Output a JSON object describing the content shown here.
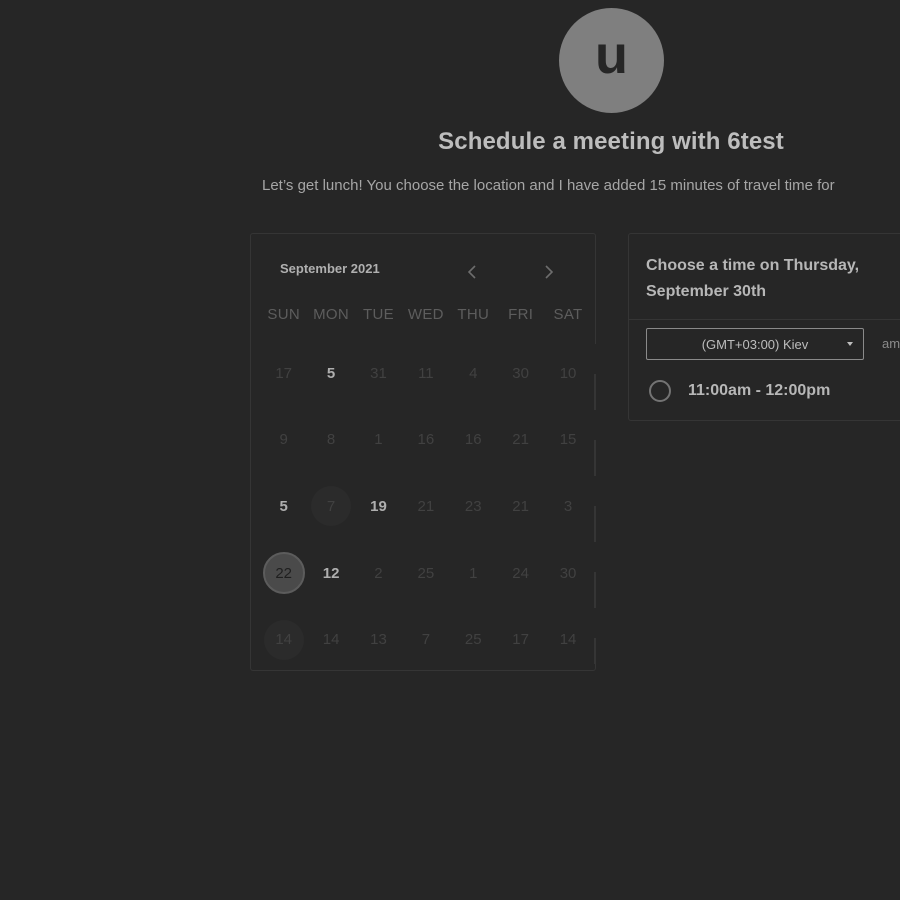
{
  "header": {
    "avatar_letter": "u",
    "title": "Schedule a meeting with 6test",
    "description": "Let’s get lunch! You choose the location and I have added 15 minutes of travel time for"
  },
  "calendar": {
    "month_label": "September 2021",
    "prev_icon": "chevron-left-icon",
    "next_icon": "chevron-right-icon",
    "weekdays": [
      "SUN",
      "MON",
      "TUE",
      "WED",
      "THU",
      "FRI",
      "SAT"
    ],
    "weeks": [
      [
        "17",
        "5",
        "31",
        "11",
        "4",
        "30",
        "10"
      ],
      [
        "9",
        "8",
        "1",
        "16",
        "16",
        "21",
        "15"
      ],
      [
        "5",
        "7",
        "19",
        "21",
        "23",
        "21",
        "3"
      ],
      [
        "22",
        "12",
        "2",
        "25",
        "1",
        "24",
        "30"
      ],
      [
        "14",
        "14",
        "13",
        "7",
        "25",
        "17",
        "14"
      ]
    ],
    "selected_day": "22"
  },
  "time_panel": {
    "title": "Choose a time on Thursday, September 30th",
    "timezone": "(GMT+03:00) Kiev",
    "format_label": "am",
    "slots": [
      "11:00am - 12:00pm"
    ]
  },
  "colors": {
    "background": "#262626",
    "avatar": "#7f7f7f",
    "border": "#353535"
  }
}
